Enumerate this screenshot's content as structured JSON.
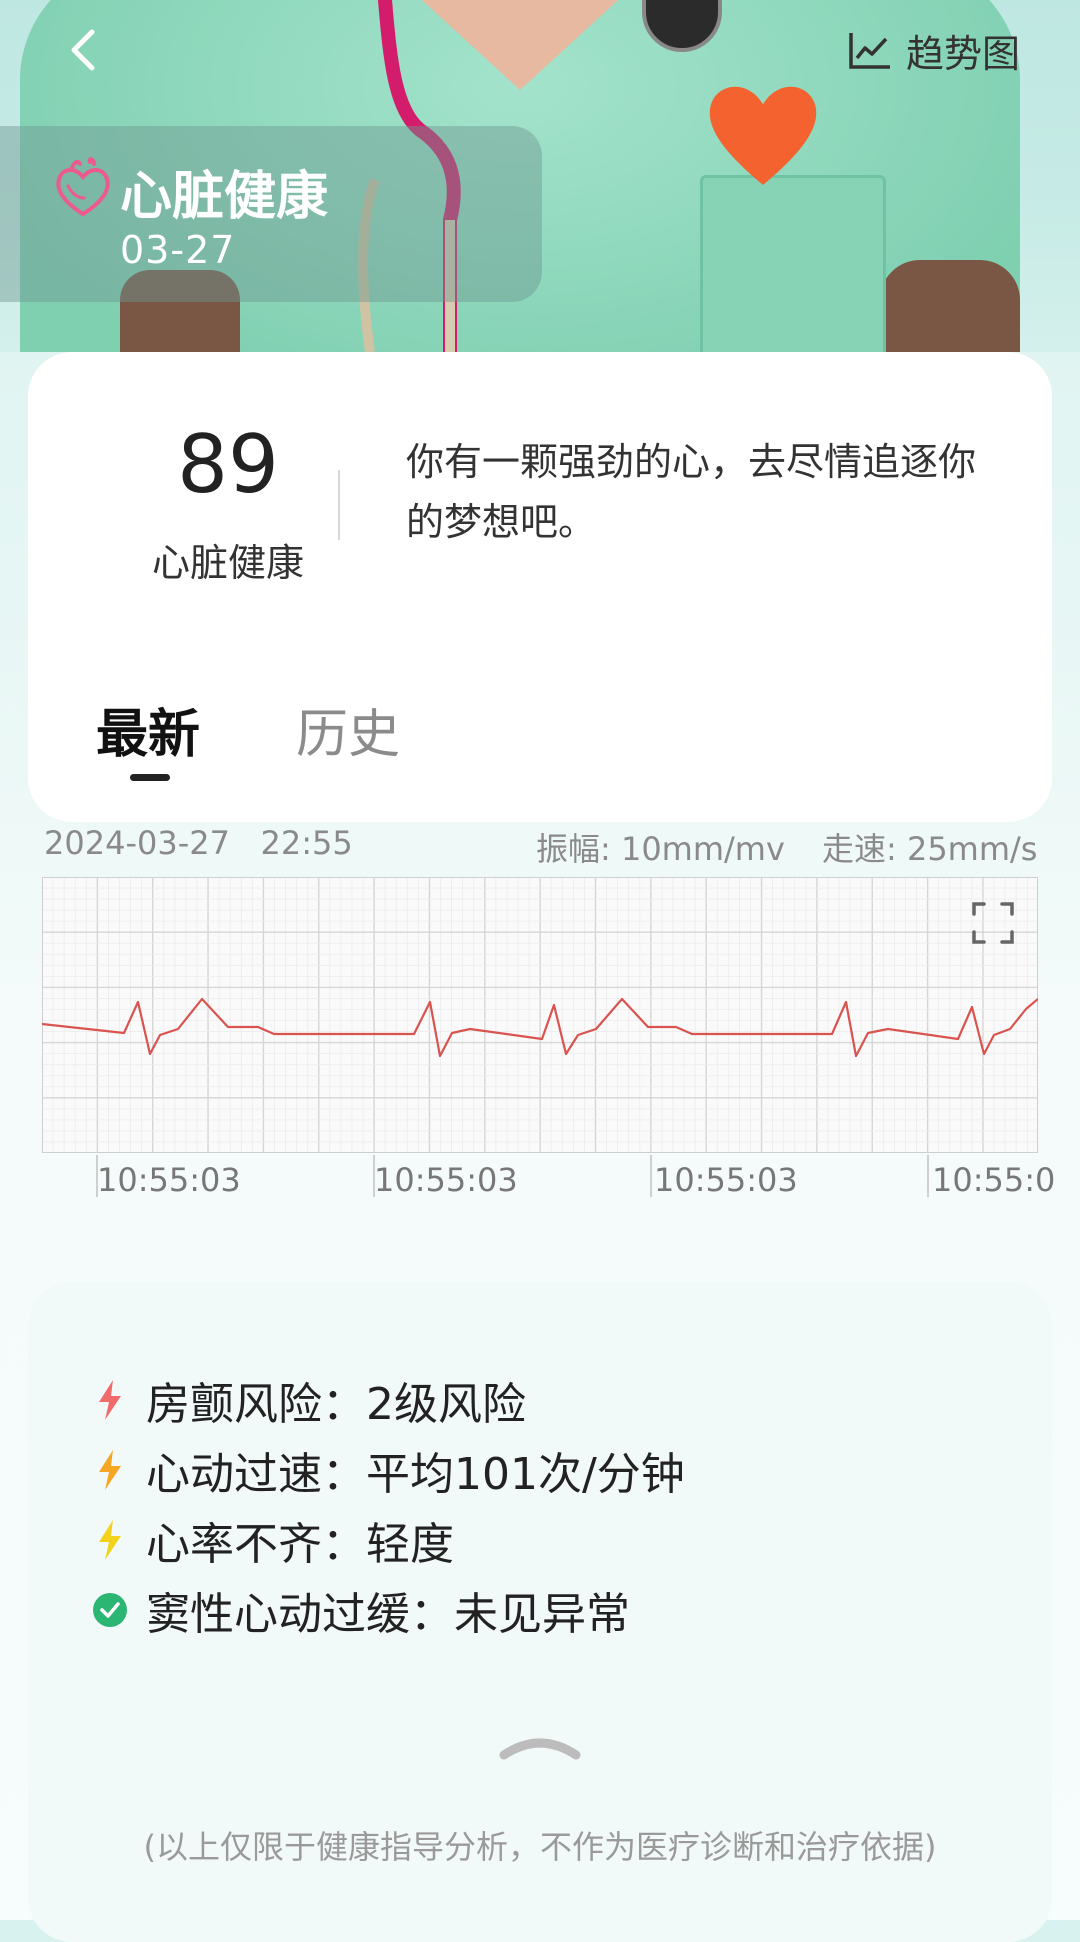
{
  "header": {
    "back_icon": "chevron-left-icon",
    "trend_label": "趋势图",
    "trend_icon": "line-chart-icon",
    "title": "心脏健康",
    "date": "03-27"
  },
  "score": {
    "value": "89",
    "label": "心脏健康",
    "message": "你有一颗强劲的心，去尽情追逐你的梦想吧。"
  },
  "tabs": [
    {
      "label": "最新",
      "active": true
    },
    {
      "label": "历史",
      "active": false
    }
  ],
  "ecg": {
    "datetime": "2024-03-27   22:55",
    "amplitude": "振幅: 10mm/mv",
    "speed": "走速: 25mm/s",
    "time_labels": [
      "10:55:03",
      "10:55:03",
      "10:55:03",
      "10:55:0"
    ],
    "line_color": "#d9534f",
    "expand_icon": "fullscreen-icon"
  },
  "results": [
    {
      "icon": "lightning-icon",
      "color": "#f06b6b",
      "text": "房颤风险：2级风险"
    },
    {
      "icon": "lightning-icon",
      "color": "#f5a623",
      "text": "心动过速：平均101次/分钟"
    },
    {
      "icon": "lightning-icon",
      "color": "#f2d21a",
      "text": "心率不齐：轻度"
    },
    {
      "icon": "check-circle-icon",
      "color": "#2bb673",
      "text": "窦性心动过缓：未见异常"
    }
  ],
  "disclaimer": "(以上仅限于健康指导分析，不作为医疗诊断和治疗依据)",
  "colors": {
    "accent_pink": "#ec5b8f",
    "background": "#e6f6f4"
  }
}
